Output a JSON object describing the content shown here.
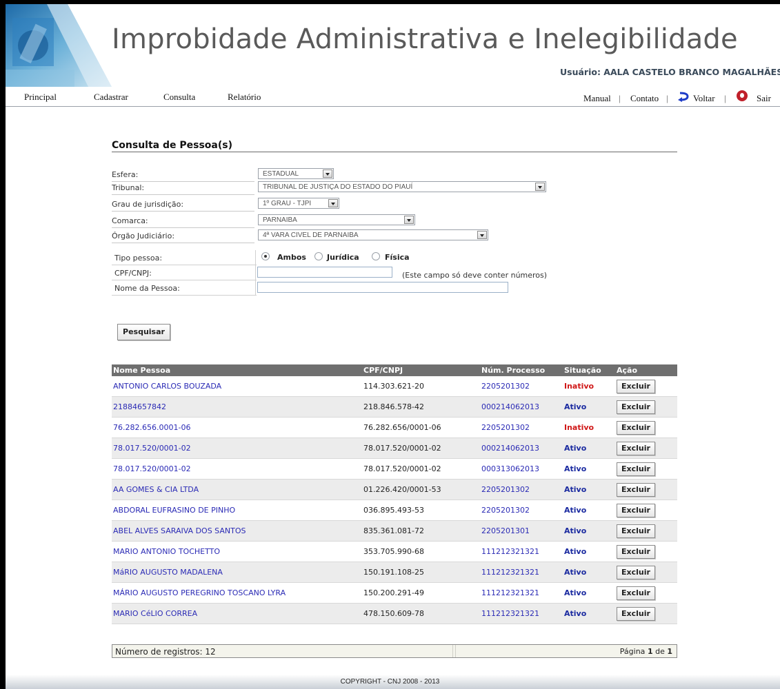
{
  "header": {
    "title": "Improbidade Administrativa e Inelegibilidade",
    "user": "Usuário: AALA CASTELO BRANCO MAGALHÃES"
  },
  "menu": {
    "principal": "Principal",
    "cadastrar": "Cadastrar",
    "consulta": "Consulta",
    "relatorio": "Relatório",
    "manual": "Manual",
    "contato": "Contato",
    "voltar": "Voltar",
    "sair": "Sair",
    "separator": "|"
  },
  "form": {
    "title": "Consulta de Pessoa(s)",
    "esfera_label": "Esfera:",
    "esfera_value": "ESTADUAL",
    "tribunal_label": "Tribunal:",
    "tribunal_value": "TRIBUNAL DE JUSTIÇA DO ESTADO DO PIAUÍ",
    "grau_label": "Grau de jurisdição:",
    "grau_value": "1º GRAU - TJPI",
    "comarca_label": "Comarca:",
    "comarca_value": "PARNAIBA",
    "orgao_label": "Órgão Judiciário:",
    "orgao_value": "4ª VARA CIVEL DE PARNAIBA",
    "tipo_label": "Tipo pessoa:",
    "tipo_options": [
      "Ambos",
      "Jurídica",
      "Física"
    ],
    "tipo_selected": "Ambos",
    "cpf_label": "CPF/CNPJ:",
    "cpf_value": "",
    "cpf_hint": "(Este campo só deve conter números)",
    "nome_label": "Nome da Pessoa:",
    "nome_value": "",
    "search_button": "Pesquisar"
  },
  "results": {
    "columns": [
      "Nome Pessoa",
      "CPF/CNPJ",
      "Núm. Processo",
      "Situação",
      "Ação"
    ],
    "action_label": "Excluir",
    "rows": [
      {
        "nome": "ANTONIO CARLOS BOUZADA",
        "cpf": "114.303.621-20",
        "processo": "2205201302",
        "situacao": "Inativo"
      },
      {
        "nome": "21884657842",
        "cpf": "218.846.578-42",
        "processo": "000214062013",
        "situacao": "Ativo"
      },
      {
        "nome": "76.282.656.0001-06",
        "cpf": "76.282.656/0001-06",
        "processo": "2205201302",
        "situacao": "Inativo"
      },
      {
        "nome": "78.017.520/0001-02",
        "cpf": "78.017.520/0001-02",
        "processo": "000214062013",
        "situacao": "Ativo"
      },
      {
        "nome": "78.017.520/0001-02",
        "cpf": "78.017.520/0001-02",
        "processo": "000313062013",
        "situacao": "Ativo"
      },
      {
        "nome": "AA GOMES & CIA LTDA",
        "cpf": "01.226.420/0001-53",
        "processo": "2205201302",
        "situacao": "Ativo"
      },
      {
        "nome": "ABDORAL EUFRASINO DE PINHO",
        "cpf": "036.895.493-53",
        "processo": "2205201302",
        "situacao": "Ativo"
      },
      {
        "nome": "ABEL ALVES SARAIVA DOS SANTOS",
        "cpf": "835.361.081-72",
        "processo": "2205201301",
        "situacao": "Ativo"
      },
      {
        "nome": "MARIO ANTONIO TOCHETTO",
        "cpf": "353.705.990-68",
        "processo": "111212321321",
        "situacao": "Ativo"
      },
      {
        "nome": "MáRIO AUGUSTO MADALENA",
        "cpf": "150.191.108-25",
        "processo": "111212321321",
        "situacao": "Ativo"
      },
      {
        "nome": "MÁRIO AUGUSTO PEREGRINO TOSCANO LYRA",
        "cpf": "150.200.291-49",
        "processo": "111212321321",
        "situacao": "Ativo"
      },
      {
        "nome": "MARIO CéLIO CORREA",
        "cpf": "478.150.609-78",
        "processo": "111212321321",
        "situacao": "Ativo"
      }
    ]
  },
  "pager": {
    "count_text": "Número de registros: 12",
    "page_prefix": "Página",
    "page_current": "1",
    "page_of": "de",
    "page_total": "1"
  },
  "footer": {
    "copyright": "COPYRIGHT - CNJ 2008 - 2013"
  },
  "colors": {
    "link": "#2a2ab5",
    "ativo": "#1a2aa0",
    "inativo": "#d01818",
    "header_row": "#6f6f6f"
  }
}
